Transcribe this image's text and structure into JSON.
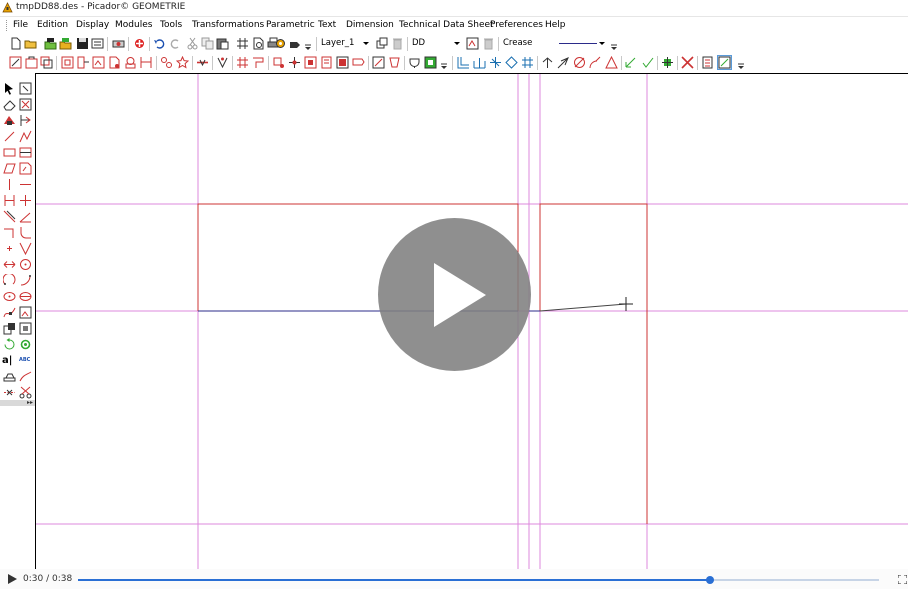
{
  "window": {
    "title": "tmpDD88.des - Picador© GEOMETRIE",
    "app_icon": "picador-app-icon"
  },
  "menu": [
    "File",
    "Edition",
    "Display",
    "Modules",
    "Tools",
    "Transformations",
    "Parametric",
    "Text",
    "Dimension",
    "Technical Data Sheet",
    "Preferences",
    "Help"
  ],
  "toolbar": {
    "layer_value": "Layer_1",
    "style_value": "DD",
    "line_type_value": "Crease",
    "file_icons": [
      "new-file-icon",
      "open-folder-icon",
      "open-recent-icon",
      "open-color-icon",
      "save-icon",
      "save-as-icon",
      "print-settings-icon",
      "import-icon"
    ],
    "edit_icons": [
      "undo-icon",
      "redo-icon",
      "cut-icon",
      "copy-icon",
      "paste-icon",
      "grid-icon",
      "print-preview-icon",
      "print-icon",
      "settings-icon",
      "export-icon"
    ]
  },
  "colors": {
    "grid_line": "#dd88dd",
    "shape_line": "#cc3333",
    "drawn_line": "#2b2b8a",
    "accent": "#2a6fd4"
  },
  "player": {
    "current_time": "0:30",
    "duration": "0:38",
    "time_separator": "/",
    "progress": 0.7895
  }
}
